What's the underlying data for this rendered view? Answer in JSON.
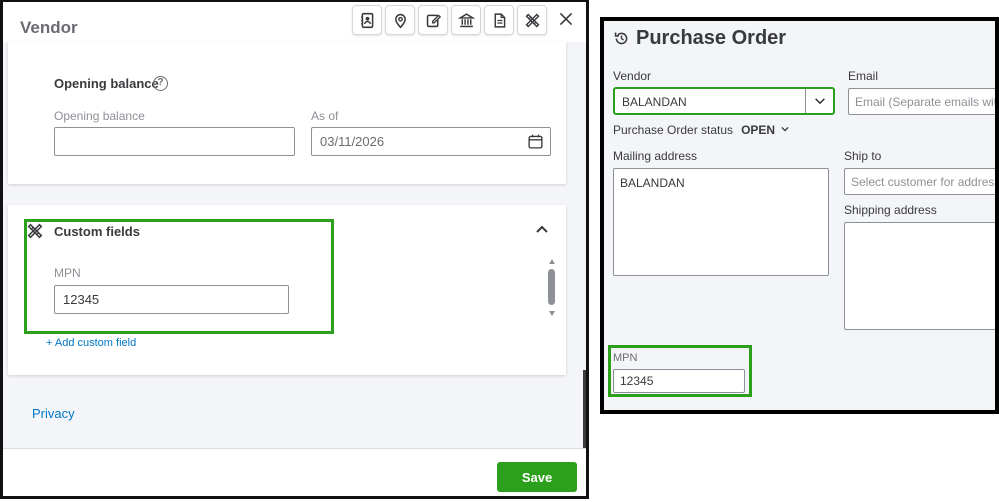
{
  "vendor_panel": {
    "title": "Vendor",
    "toolbar_icons": [
      "contact-card-icon",
      "location-pin-icon",
      "edit-note-icon",
      "bank-icon",
      "document-icon",
      "tools-icon"
    ],
    "close_icon": "close-icon",
    "opening_balance": {
      "section_title": "Opening balance",
      "help_icon": "help-icon",
      "help_glyph": "?",
      "balance_label": "Opening balance",
      "balance_value": "",
      "as_of_label": "As of",
      "as_of_value": "03/11/2026",
      "calendar_icon": "calendar-icon"
    },
    "custom_fields": {
      "section_title": "Custom fields",
      "section_icon": "tools-icon",
      "field_label": "MPN",
      "field_value": "12345",
      "add_link": "+ Add custom field"
    },
    "privacy_link": "Privacy",
    "save_button": "Save"
  },
  "purchase_order": {
    "title": "Purchase Order",
    "title_icon": "history-icon",
    "vendor_label": "Vendor",
    "vendor_value": "BALANDAN",
    "email_label": "Email",
    "email_placeholder": "Email (Separate emails with",
    "status_label": "Purchase Order status",
    "status_value": "OPEN",
    "mailing_label": "Mailing address",
    "mailing_value": "BALANDAN",
    "ship_to_label": "Ship to",
    "ship_to_placeholder": "Select customer for address",
    "shipping_address_label": "Shipping address",
    "mpn_label": "MPN",
    "mpn_value": "12345"
  },
  "colors": {
    "accent_green": "#2ca01c",
    "link_blue": "#0077c5",
    "text_dark": "#393a3d",
    "text_muted": "#8d9096"
  }
}
